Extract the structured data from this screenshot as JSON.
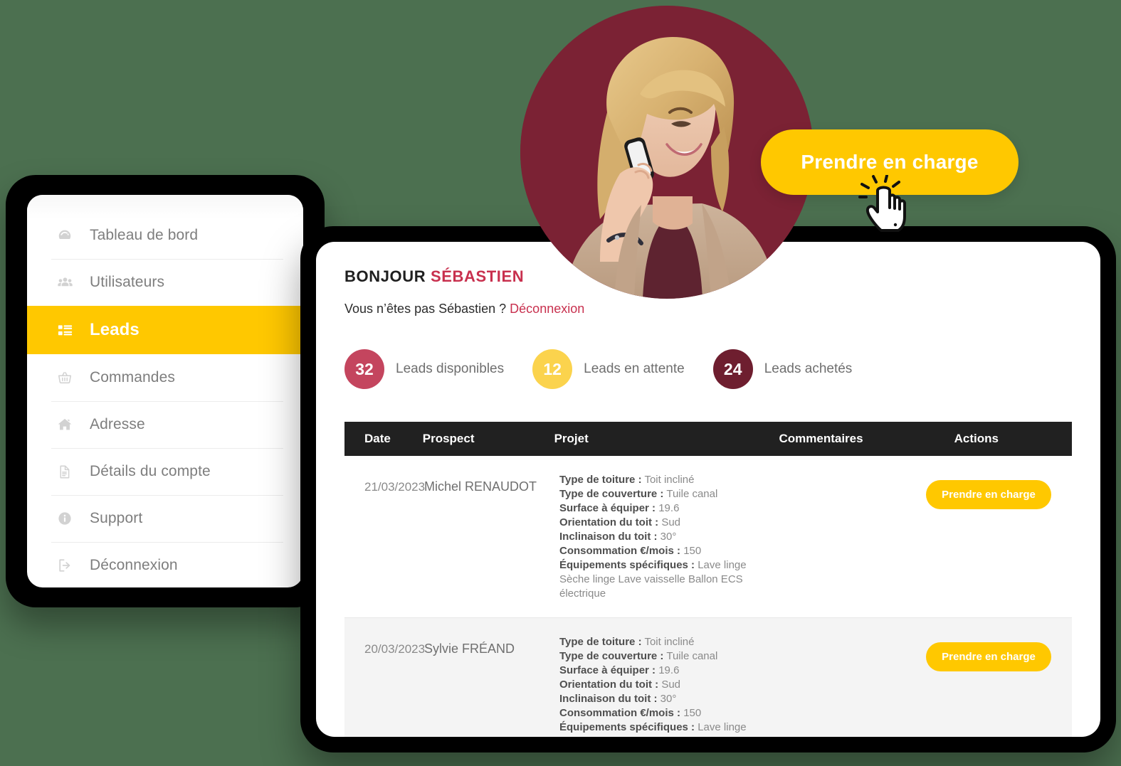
{
  "background_color": "#4C7050",
  "accent": {
    "yellow": "#FFC800",
    "crimson": "#C8304E",
    "rose": "#C4455E",
    "maroon": "#7B2234",
    "dark_maroon": "#6E1E2F",
    "header_black": "#212121"
  },
  "sidebar": {
    "items": [
      {
        "label": "Tableau de bord",
        "icon": "dashboard-gauge-icon",
        "active": false
      },
      {
        "label": "Utilisateurs",
        "icon": "users-icon",
        "active": false
      },
      {
        "label": "Leads",
        "icon": "list-grid-icon",
        "active": true
      },
      {
        "label": "Commandes",
        "icon": "basket-icon",
        "active": false
      },
      {
        "label": "Adresse",
        "icon": "home-icon",
        "active": false
      },
      {
        "label": "Détails du compte",
        "icon": "file-document-icon",
        "active": false
      },
      {
        "label": "Support",
        "icon": "info-circle-icon",
        "active": false
      },
      {
        "label": "Déconnexion",
        "icon": "sign-out-icon",
        "active": false
      }
    ]
  },
  "header": {
    "greeting_prefix": "BONJOUR ",
    "greeting_name": "SÉBASTIEN",
    "not_you_text": "Vous n’êtes pas Sébastien ? ",
    "logout_link": "Déconnexion"
  },
  "stats": [
    {
      "count": "32",
      "label": "Leads disponibles",
      "color": "#C4455E"
    },
    {
      "count": "12",
      "label": "Leads en attente",
      "color": "#FBD34D"
    },
    {
      "count": "24",
      "label": "Leads achetés",
      "color": "#6E1E2F"
    }
  ],
  "table": {
    "columns": [
      "Date",
      "Prospect",
      "Projet",
      "Commentaires",
      "Actions"
    ],
    "rows": [
      {
        "date": "21/03/2023",
        "prospect": "Michel RENAUDOT",
        "comment": "",
        "action_label": "Prendre en charge",
        "project": [
          {
            "key": "Type de toiture :",
            "value": " Toit incliné"
          },
          {
            "key": "Type de couverture :",
            "value": " Tuile canal"
          },
          {
            "key": "Surface à équiper :",
            "value": " 19.6"
          },
          {
            "key": "Orientation du toit :",
            "value": " Sud"
          },
          {
            "key": "Inclinaison du toit :",
            "value": " 30°"
          },
          {
            "key": "Consommation €/mois :",
            "value": " 150"
          },
          {
            "key": "Équipements spécifiques :",
            "value": " Lave linge Sèche linge Lave vaisselle Ballon ECS électrique"
          }
        ]
      },
      {
        "date": "20/03/2023",
        "prospect": "Sylvie FRÉAND",
        "comment": "",
        "action_label": "Prendre en charge",
        "project": [
          {
            "key": "Type de toiture :",
            "value": " Toit incliné"
          },
          {
            "key": "Type de couverture :",
            "value": " Tuile canal"
          },
          {
            "key": "Surface à équiper :",
            "value": " 19.6"
          },
          {
            "key": "Orientation du toit :",
            "value": " Sud"
          },
          {
            "key": "Inclinaison du toit :",
            "value": " 30°"
          },
          {
            "key": "Consommation €/mois :",
            "value": " 150"
          },
          {
            "key": "Équipements spécifiques :",
            "value": " Lave linge Sèche linge"
          }
        ]
      }
    ]
  },
  "floating_cta": {
    "label": "Prendre en charge",
    "cursor_icon": "pointing-hand-cursor-icon"
  },
  "hero": {
    "image_alt": "woman-smiling-on-phone-photo",
    "circle_background": "#7B2234"
  }
}
